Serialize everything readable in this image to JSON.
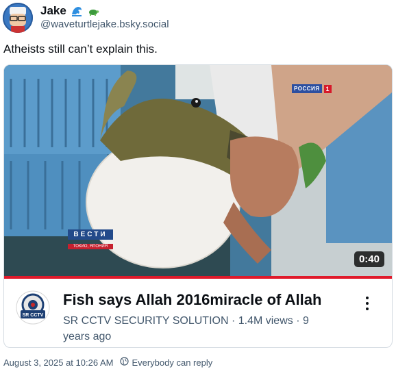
{
  "author": {
    "display_name": "Jake",
    "handle": "@waveturtlejake.bsky.social",
    "badges": [
      "wave-emoji",
      "turtle-emoji"
    ]
  },
  "post": {
    "text": "Atheists still can’t explain this."
  },
  "embed": {
    "duration": "0:40",
    "tv_logo_word": "РОССИЯ",
    "tv_logo_num": "1",
    "chyron_title": "ВЕСТИ",
    "chyron_subtitle": "ТОКИО, ЯПОНИЯ",
    "title": "Fish says Allah 2016miracle of Allah",
    "meta": "SR CCTV SECURITY SOLUTION · 1.4M views · 9 years ago",
    "channel_logo_text": "SR CCTV SECURITY"
  },
  "footer": {
    "timestamp": "August 3, 2025 at 10:26 AM",
    "reply_setting": "Everybody can reply"
  },
  "colors": {
    "progress": "#e01a2b",
    "text_primary": "#0b0f14",
    "text_secondary": "#42576c",
    "border": "#d4dbe2"
  }
}
